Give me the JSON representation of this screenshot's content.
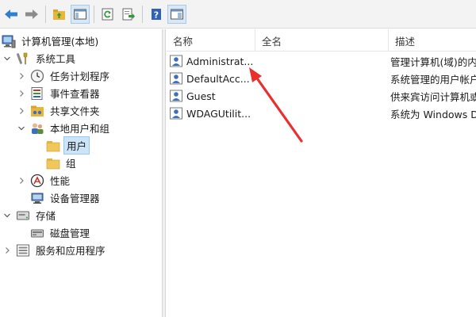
{
  "toolbar": {
    "buttons": [
      "back-icon",
      "forward-icon",
      "up-folder-icon",
      "show-hide-tree-icon",
      "refresh-icon",
      "export-list-icon",
      "help-icon",
      "properties-icon"
    ]
  },
  "tree": {
    "root": "计算机管理(本地)",
    "system_tools": "系统工具",
    "task_scheduler": "任务计划程序",
    "event_viewer": "事件查看器",
    "shared_folders": "共享文件夹",
    "local_users_groups": "本地用户和组",
    "users": "用户",
    "groups": "组",
    "performance": "性能",
    "device_manager": "设备管理器",
    "storage": "存储",
    "disk_management": "磁盘管理",
    "services_apps": "服务和应用程序"
  },
  "list": {
    "columns": [
      "名称",
      "全名",
      "描述"
    ],
    "rows": [
      {
        "name": "Administrat...",
        "fullname": "",
        "desc": "管理计算机(域)的内置帐户"
      },
      {
        "name": "DefaultAcc...",
        "fullname": "",
        "desc": "系统管理的用户帐户。"
      },
      {
        "name": "Guest",
        "fullname": "",
        "desc": "供来宾访问计算机或访问域的内置帐户"
      },
      {
        "name": "WDAGUtilit...",
        "fullname": "",
        "desc": "系统为 Windows Defender 应用程序防护方案管理和使用的用户帐户。"
      }
    ]
  },
  "colors": {
    "accent_arrow": "#e8312f",
    "selection": "#cce4f7"
  }
}
